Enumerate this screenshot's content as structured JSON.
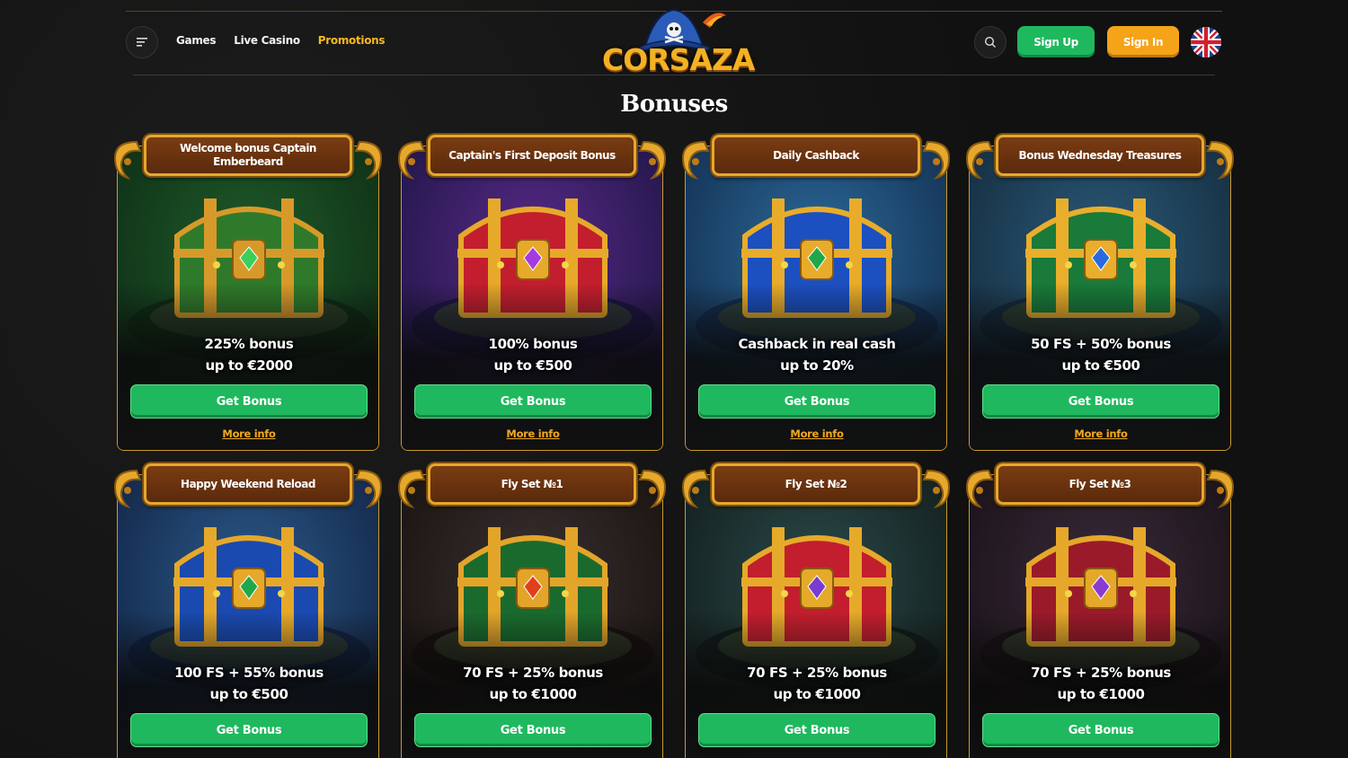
{
  "header": {
    "nav": [
      {
        "label": "Games"
      },
      {
        "label": "Live Casino"
      },
      {
        "label": "Promotions"
      }
    ],
    "logo_text": "CORSAZA",
    "signup_label": "Sign Up",
    "signin_label": "Sign In",
    "language_flag": "uk-flag-icon"
  },
  "page_title": "Bonuses",
  "cards": [
    {
      "title": "Welcome bonus Captain Emberbeard",
      "line1": "225% bonus",
      "line2": "up to €2000",
      "button": "Get Bonus",
      "more": "More info",
      "theme": "jungle"
    },
    {
      "title": "Captain's First Deposit Bonus",
      "line1": "100% bonus",
      "line2": "up to €500",
      "button": "Get Bonus",
      "more": "More info",
      "theme": "ruby"
    },
    {
      "title": "Daily Cashback",
      "line1": "Cashback in real cash",
      "line2": "up to 20%",
      "button": "Get Bonus",
      "more": "More info",
      "theme": "sapphire"
    },
    {
      "title": "Bonus Wednesday Treasures",
      "line1": "50 FS + 50% bonus",
      "line2": "up to €500",
      "button": "Get Bonus",
      "more": "More info",
      "theme": "emerald"
    },
    {
      "title": "Happy Weekend Reload",
      "line1": "100 FS + 55% bonus",
      "line2": "up to €500",
      "button": "Get Bonus",
      "theme": "island"
    },
    {
      "title": "Fly Set №1",
      "line1": "70 FS + 25% bonus",
      "line2": "up to €1000",
      "button": "Get Bonus",
      "theme": "eye"
    },
    {
      "title": "Fly Set №2",
      "line1": "70 FS + 25% bonus",
      "line2": "up to €1000",
      "button": "Get Bonus",
      "theme": "crystal"
    },
    {
      "title": "Fly Set №3",
      "line1": "70 FS + 25% bonus",
      "line2": "up to €1000",
      "button": "Get Bonus",
      "theme": "cave"
    }
  ]
}
